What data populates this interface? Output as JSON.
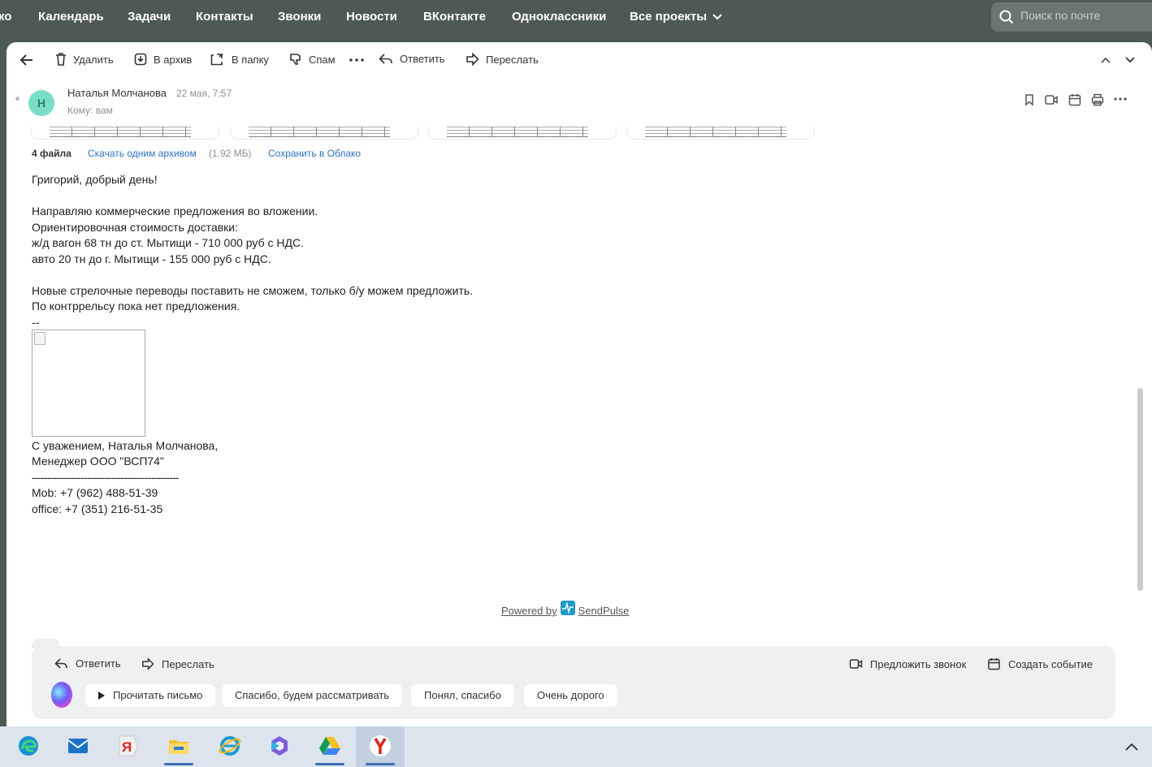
{
  "topnav": {
    "items": [
      "ко",
      "Календарь",
      "Задачи",
      "Контакты",
      "Звонки",
      "Новости",
      "ВКонтакте",
      "Одноклассники",
      "Все проекты"
    ],
    "search_placeholder": "Поиск по почте"
  },
  "toolbar": {
    "delete": "Удалить",
    "archive": "В архив",
    "move": "В папку",
    "spam": "Спам",
    "reply": "Ответить",
    "forward": "Переслать"
  },
  "message": {
    "avatar_letter": "Н",
    "sender": "Наталья Молчанова",
    "date": "22 мая, 7:57",
    "recipient": "Кому: вам",
    "files_count": "4 файла",
    "download_all": "Скачать одним архивом",
    "download_size": "(1.92 МБ)",
    "save_cloud": "Сохранить в Облако",
    "body_lines": [
      "Григорий, добрый день!",
      "",
      "Направляю коммерческие предложения во вложении.",
      "Ориентировочная стоимость доставки:",
      "ж/д вагон 68 тн до ст. Мытищи - 710 000 руб с НДС.",
      "авто 20 тн до г. Мытищи - 155 000 руб с НДС.",
      "",
      "Новые стрелочные переводы поставить не сможем, только б/у можем предложить.",
      "По контррельсу пока нет предложения.",
      "--"
    ],
    "signature_lines": [
      "С уважением, Наталья Молчанова,",
      "Менеджер ООО \"ВСП74\"",
      "------------------------------------------------",
      "Mob: +7 (962) 488-51-39",
      "office: +7 (351) 216-51-35"
    ],
    "powered_prefix": "Powered by",
    "powered_brand": "SendPulse"
  },
  "quick": {
    "reply": "Ответить",
    "forward": "Переслать",
    "propose_call": "Предложить звонок",
    "create_event": "Создать событие",
    "chips": [
      "Прочитать письмо",
      "Спасибо, будем рассматривать",
      "Понял, спасибо",
      "Очень дорого"
    ]
  },
  "taskbar": {
    "apps": [
      "edge-icon",
      "mail-icon",
      "yandex-browser-icon",
      "file-explorer-icon",
      "internet-explorer-icon",
      "copilot-icon",
      "google-drive-icon",
      "yandex-icon"
    ],
    "active_app": "yandex-icon"
  },
  "colors": {
    "topbar": "#4d5a54",
    "avatar": "#77dfc6",
    "link": "#2d6fd1",
    "quick_panel": "#eef0f2",
    "taskbar": "#dce4ee"
  }
}
